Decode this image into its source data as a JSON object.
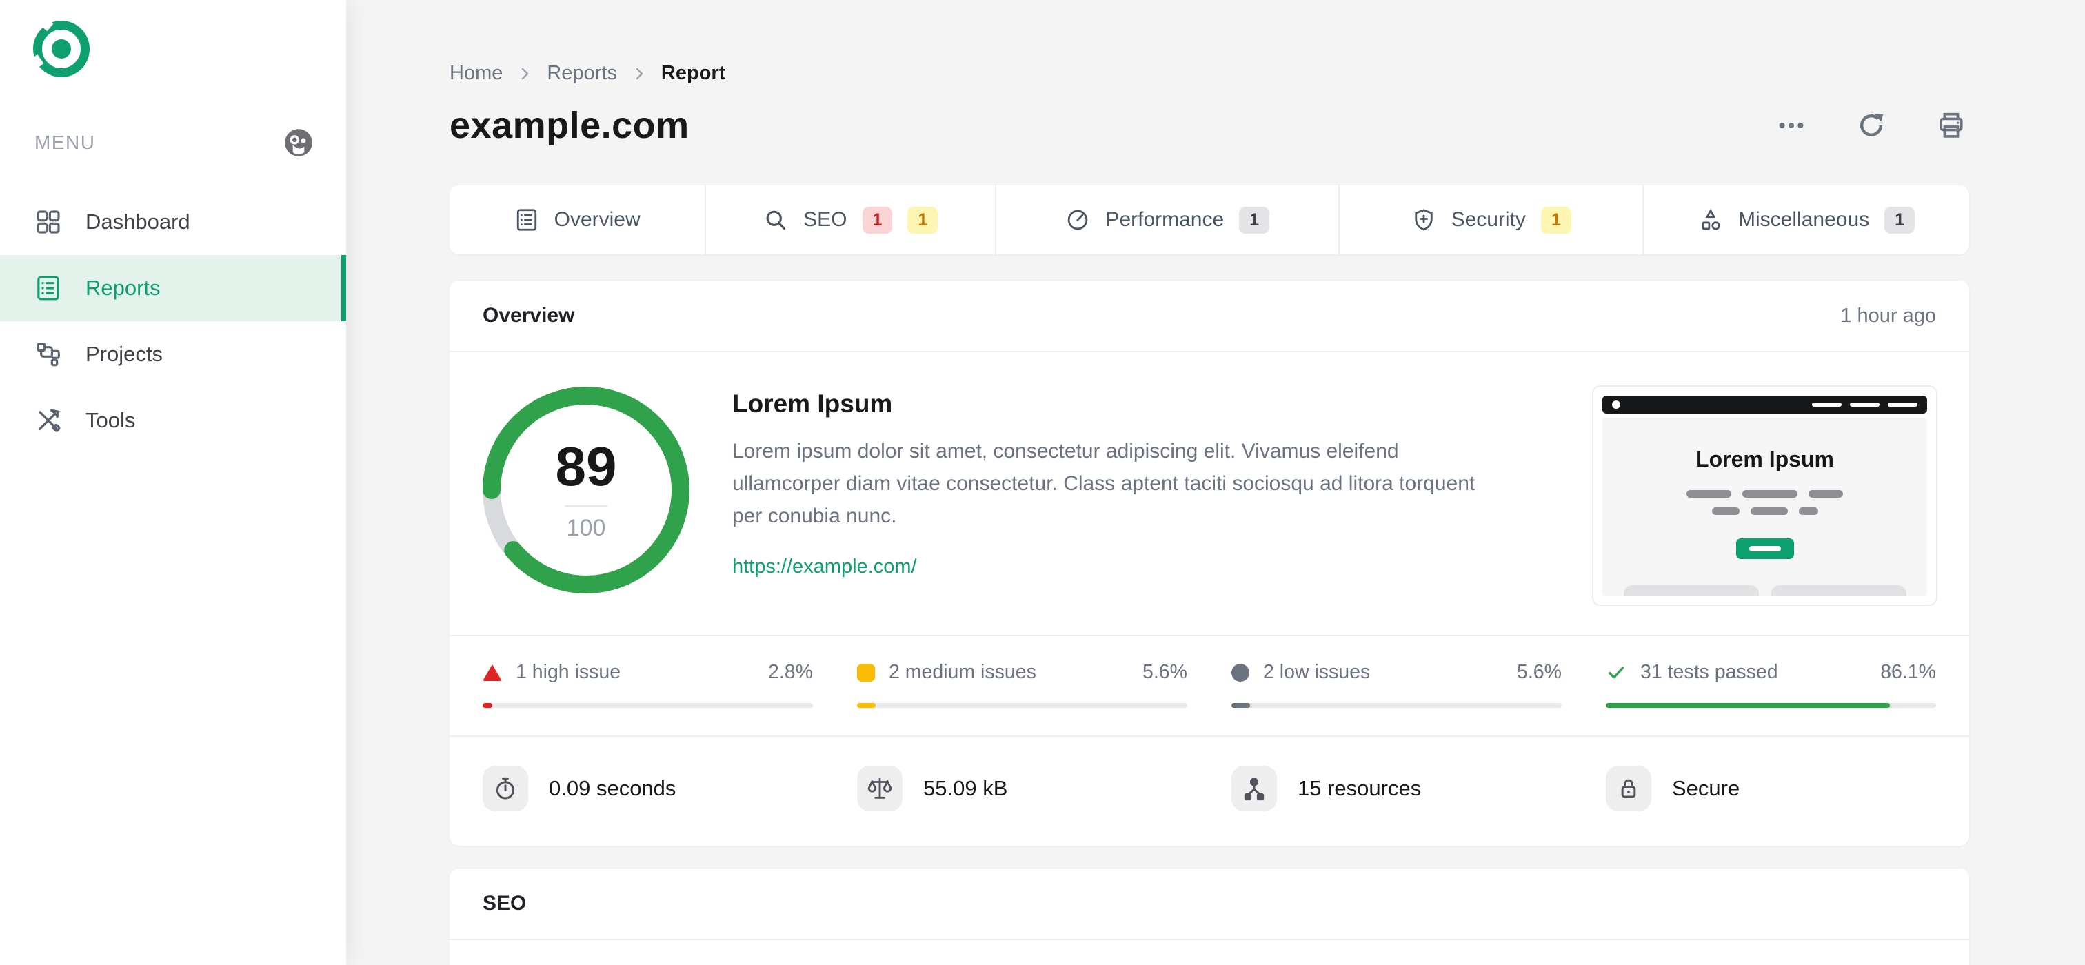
{
  "sidebar": {
    "menu_label": "MENU",
    "items": [
      {
        "label": "Dashboard",
        "icon": "grid-icon",
        "active": false
      },
      {
        "label": "Reports",
        "icon": "report-list-icon",
        "active": true
      },
      {
        "label": "Projects",
        "icon": "workflow-icon",
        "active": false
      },
      {
        "label": "Tools",
        "icon": "tools-icon",
        "active": false
      }
    ]
  },
  "header": {
    "breadcrumb": [
      {
        "label": "Home",
        "current": false
      },
      {
        "label": "Reports",
        "current": false
      },
      {
        "label": "Report",
        "current": true
      }
    ],
    "title": "example.com",
    "actions": [
      {
        "name": "more-options",
        "icon": "ellipsis-icon"
      },
      {
        "name": "refresh",
        "icon": "refresh-icon"
      },
      {
        "name": "print",
        "icon": "printer-icon"
      }
    ]
  },
  "tabs": [
    {
      "label": "Overview",
      "icon": "overview-icon",
      "badges": []
    },
    {
      "label": "SEO",
      "icon": "search-icon",
      "badges": [
        {
          "text": "1",
          "type": "red"
        },
        {
          "text": "1",
          "type": "yellow"
        }
      ]
    },
    {
      "label": "Performance",
      "icon": "gauge-icon",
      "badges": [
        {
          "text": "1",
          "type": "gray"
        }
      ]
    },
    {
      "label": "Security",
      "icon": "shield-icon",
      "badges": [
        {
          "text": "1",
          "type": "yellow"
        }
      ]
    },
    {
      "label": "Miscellaneous",
      "icon": "shapes-icon",
      "badges": [
        {
          "text": "1",
          "type": "gray"
        }
      ]
    }
  ],
  "overview_card": {
    "title": "Overview",
    "timestamp": "1 hour ago",
    "score": {
      "value": "89",
      "max": "100",
      "percent": 89,
      "color": "#2fa24b",
      "track_color": "#d9dade"
    },
    "site": {
      "heading": "Lorem Ipsum",
      "description": "Lorem ipsum dolor sit amet, consectetur adipiscing elit. Vivamus eleifend ullamcorper diam vitae consectetur. Class aptent taciti sociosqu ad litora torquent per conubia nunc.",
      "url": "https://example.com/"
    },
    "thumbnail": {
      "heading": "Lorem Ipsum",
      "button_color": "#0e9f6e"
    },
    "stats": [
      {
        "icon": "high-issue-triangle-icon",
        "label": "1 high issue",
        "percent_label": "2.8%",
        "percent": 2.8,
        "color": "#e02424"
      },
      {
        "icon": "medium-issue-square-icon",
        "label": "2 medium issues",
        "percent_label": "5.6%",
        "percent": 5.6,
        "color": "#fbbc05"
      },
      {
        "icon": "low-issue-circle-icon",
        "label": "2 low issues",
        "percent_label": "5.6%",
        "percent": 5.6,
        "color": "#6b7280"
      },
      {
        "icon": "check-icon",
        "label": "31 tests passed",
        "percent_label": "86.1%",
        "percent": 86.1,
        "color": "#2fa24b"
      }
    ],
    "metrics": [
      {
        "icon": "stopwatch-icon",
        "label": "0.09 seconds"
      },
      {
        "icon": "scale-icon",
        "label": "55.09 kB"
      },
      {
        "icon": "resources-icon",
        "label": "15 resources"
      },
      {
        "icon": "lock-icon",
        "label": "Secure"
      }
    ]
  },
  "seo_card": {
    "title": "SEO"
  },
  "colors": {
    "brand_green": "#0e9f6e",
    "active_bg": "#e3f3eb",
    "page_bg": "#f4f4f5",
    "badge_red_bg": "#fbd5d5",
    "badge_red_text": "#c81e1e",
    "badge_yellow_bg": "#fdf6b2",
    "badge_yellow_text": "#c27803",
    "badge_gray_bg": "#e4e4e7"
  }
}
